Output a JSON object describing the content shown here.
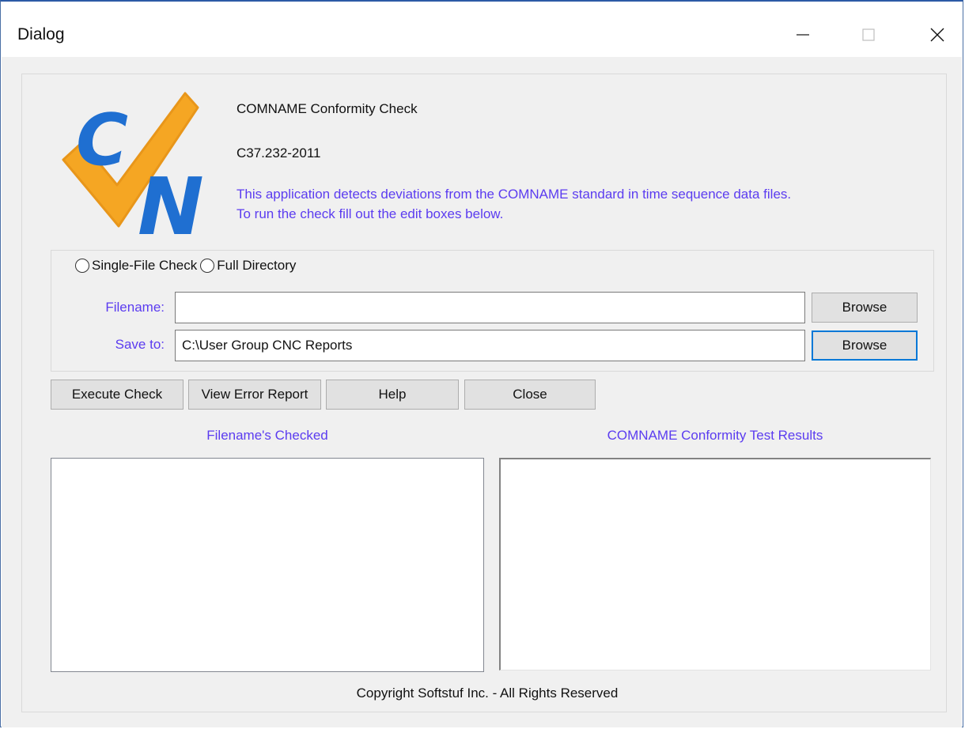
{
  "window": {
    "title": "Dialog"
  },
  "header": {
    "app_title": "COMNAME Conformity Check",
    "version": "C37.232-2011",
    "description": "This application detects deviations from the COMNAME standard in time sequence data files.\nTo run the check fill out the edit boxes below.",
    "logo_letters": "CN",
    "logo_colors": {
      "check": "#f5a623",
      "letters": "#1f6fd1"
    }
  },
  "mode": {
    "options": [
      {
        "label": "Single-File Check",
        "selected": false
      },
      {
        "label": "Full Directory",
        "selected": false
      }
    ]
  },
  "form": {
    "filename_label": "Filename:",
    "filename_value": "",
    "saveto_label": "Save to:",
    "saveto_value": "C:\\User Group CNC Reports",
    "browse_label": "Browse"
  },
  "actions": {
    "execute": "Execute Check",
    "view_report": "View Error Report",
    "help": "Help",
    "close": "Close"
  },
  "lists": {
    "files_header": "Filename's Checked",
    "results_header": "COMNAME Conformity Test Results"
  },
  "footer": {
    "copyright": "Copyright Softstuf Inc. - All Rights Reserved"
  },
  "colors": {
    "accent_text": "#5b3cf0",
    "focus_border": "#0078d7"
  }
}
